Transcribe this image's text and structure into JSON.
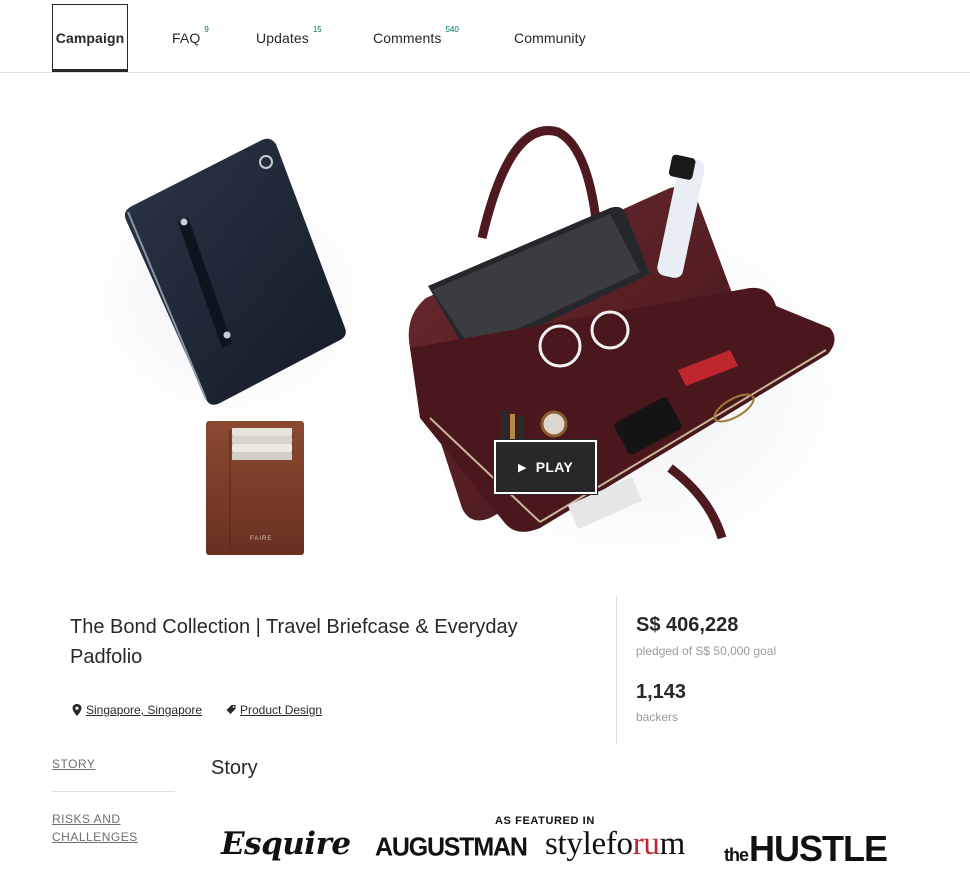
{
  "tabs": [
    {
      "label": "Campaign",
      "count": ""
    },
    {
      "label": "FAQ",
      "count": "9"
    },
    {
      "label": "Updates",
      "count": "15"
    },
    {
      "label": "Comments",
      "count": "540"
    },
    {
      "label": "Community",
      "count": ""
    }
  ],
  "hero": {
    "play_label": "PLAY",
    "wallet_brand": "FAIRE"
  },
  "project": {
    "title": "The Bond Collection | Travel Briefcase & Everyday Padfolio",
    "location": "Singapore, Singapore",
    "category": "Product Design"
  },
  "stats": {
    "pledged": "S$ 406,228",
    "goal_text": "pledged of S$ 50,000 goal",
    "backers": "1,143",
    "backers_label": "backers"
  },
  "story_nav": {
    "story": "STORY",
    "risks": "RISKS AND CHALLENGES"
  },
  "story": {
    "heading": "Story",
    "featured_label": "AS FEATURED IN",
    "logos": {
      "esquire": "Esquire",
      "augustman": "AUGUSTMAN",
      "styleforum_a": "stylefo",
      "styleforum_b": "ru",
      "styleforum_c": "m",
      "hustle_the": "the",
      "hustle_main": "HUSTLE"
    }
  },
  "colors": {
    "text": "#282828",
    "accent_green": "#037362",
    "muted": "#9a9a9a",
    "divider": "#dcdedd",
    "leather_burgundy": "#5a1f24",
    "padfolio_navy": "#1b2533",
    "wallet_brown": "#7a3a26"
  },
  "icons": {
    "location": "map-pin-icon",
    "category": "tag-icon",
    "play": "play-icon"
  }
}
